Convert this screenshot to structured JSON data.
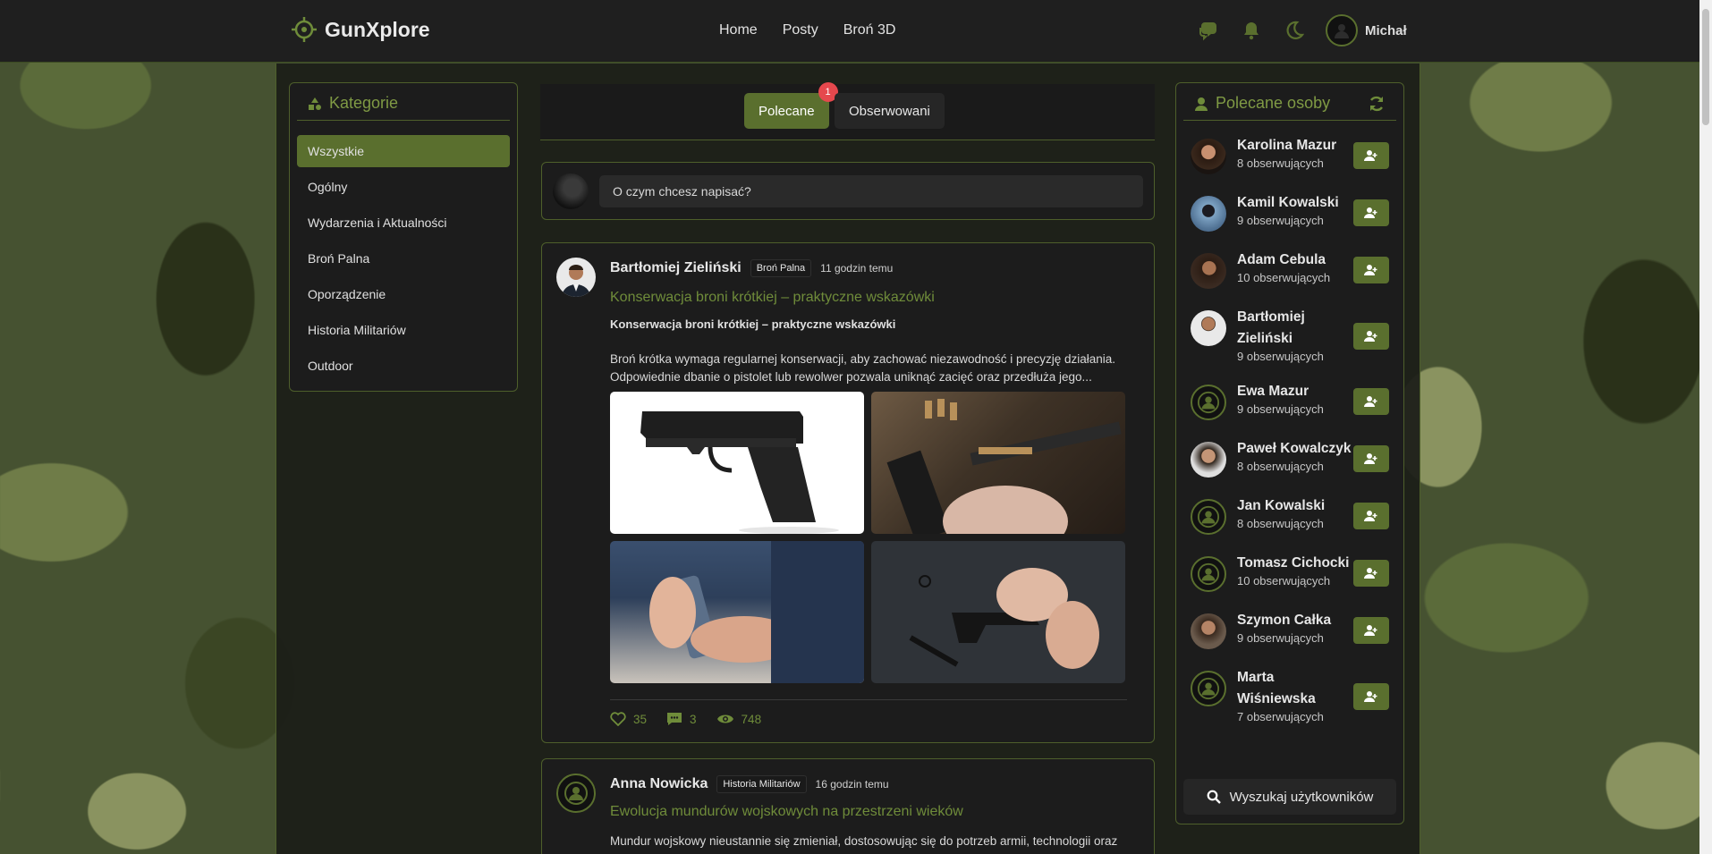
{
  "brand": {
    "title": "GunXplore"
  },
  "nav": [
    "Home",
    "Posty",
    "Broń 3D"
  ],
  "user": {
    "name": "Michał"
  },
  "categories": {
    "title": "Kategorie",
    "items": [
      "Wszystkie",
      "Ogólny",
      "Wydarzenia i Aktualności",
      "Broń Palna",
      "Oporządzenie",
      "Historia Militariów",
      "Outdoor"
    ],
    "active_index": 0
  },
  "feed_tabs": {
    "recommended": "Polecane",
    "recommended_badge": "1",
    "following": "Obserwowani"
  },
  "composer": {
    "placeholder": "O czym chcesz napisać?"
  },
  "posts": [
    {
      "author": "Bartłomiej Zieliński",
      "category": "Broń Palna",
      "time": "11 godzin temu",
      "title": "Konserwacja broni krótkiej – praktyczne wskazówki",
      "subtitle": "Konserwacja broni krótkiej – praktyczne wskazówki",
      "body": "Broń krótka wymaga regularnej konserwacji, aby zachować niezawodność i precyzję działania. Odpowiednie dbanie o pistolet lub rewolwer pozwala uniknąć zacięć oraz przedłuża jego...",
      "likes": "35",
      "comments": "3",
      "views": "748"
    },
    {
      "author": "Anna Nowicka",
      "category": "Historia Militariów",
      "time": "16 godzin temu",
      "title": "Ewolucja mundurów wojskowych na przestrzeni wieków",
      "body": "Mundur wojskowy nieustannie się zmieniał, dostosowując się do potrzeb armii, technologii oraz"
    }
  ],
  "suggested": {
    "title": "Polecane osoby",
    "people": [
      {
        "name": "Karolina Mazur",
        "followers": "8 obserwujących"
      },
      {
        "name": "Kamil Kowalski",
        "followers": "9 obserwujących"
      },
      {
        "name": "Adam Cebula",
        "followers": "10 obserwujących"
      },
      {
        "name": "Bartłomiej Zieliński",
        "followers": "9 obserwujących"
      },
      {
        "name": "Ewa Mazur",
        "followers": "9 obserwujących"
      },
      {
        "name": "Paweł Kowalczyk",
        "followers": "8 obserwujących"
      },
      {
        "name": "Jan Kowalski",
        "followers": "8 obserwujących"
      },
      {
        "name": "Tomasz Cichocki",
        "followers": "10 obserwujących"
      },
      {
        "name": "Szymon Całka",
        "followers": "9 obserwujących"
      },
      {
        "name": "Marta Wiśniewska",
        "followers": "7 obserwujących"
      }
    ],
    "search_label": "Wyszukaj użytkowników"
  },
  "colors": {
    "accent": "#5a6f2e",
    "accent_text": "#6f8c3a",
    "badge": "#e5484d",
    "panel": "#1c1c1c"
  }
}
